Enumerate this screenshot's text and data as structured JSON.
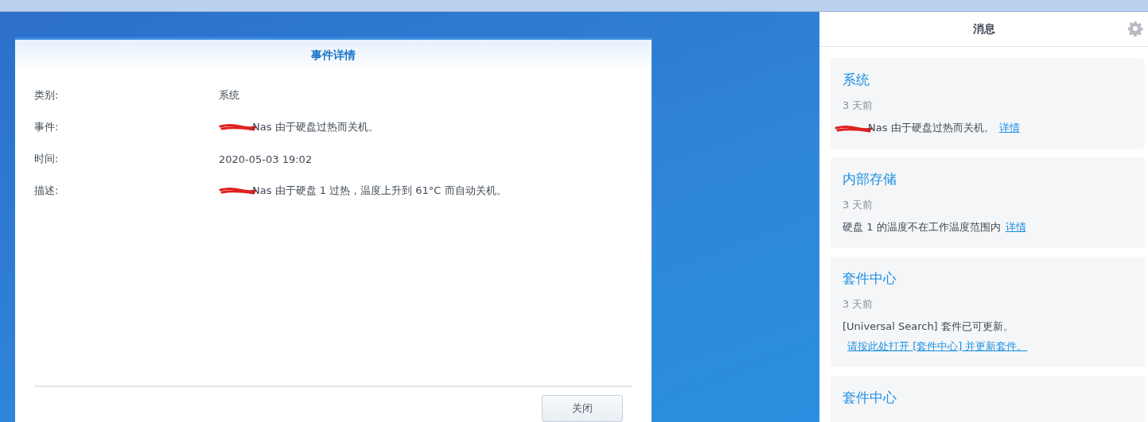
{
  "dialog": {
    "title": "事件详情",
    "fields": [
      {
        "label": "类别:",
        "value": "系统",
        "redacted": false
      },
      {
        "label": "事件:",
        "value": "Nas 由于硬盘过热而关机。",
        "redacted": true
      },
      {
        "label": "时间:",
        "value": "2020-05-03 19:02",
        "redacted": false
      },
      {
        "label": "描述:",
        "value": "Nas 由于硬盘 1 过热，温度上升到 61°C 而自动关机。",
        "redacted": true
      }
    ],
    "buttons": [
      "关闭"
    ]
  },
  "notifications": {
    "title": "消息",
    "items": [
      {
        "title": "系统",
        "time": "3 天前",
        "text": "Nas 由于硬盘过热而关机。",
        "link": "详情",
        "redacted": true
      },
      {
        "title": "内部存储",
        "time": "3 天前",
        "text": "硬盘 1 的温度不在工作温度范围内",
        "link": "详情",
        "redacted": false
      },
      {
        "title": "套件中心",
        "time": "3 天前",
        "text": "[Universal Search] 套件已可更新。",
        "link": "请按此处打开 [套件中心] 并更新套件。",
        "redacted": false
      },
      {
        "title": "套件中心"
      }
    ]
  }
}
